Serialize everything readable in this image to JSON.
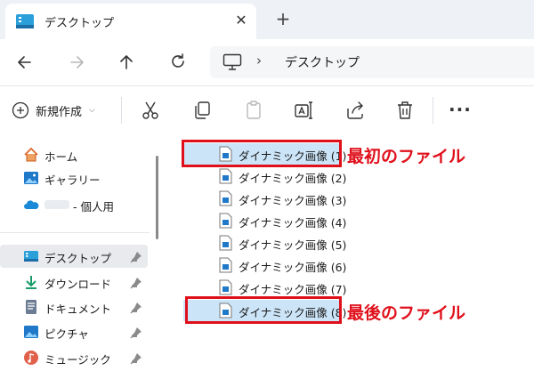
{
  "window": {
    "tab_title": "デスクトップ",
    "tab_close": "✕",
    "new_tab": "+"
  },
  "address": {
    "separator": "›",
    "location": "デスクトップ"
  },
  "toolbar": {
    "new_label": "新規作成",
    "new_caret": "⌵",
    "more": "···"
  },
  "sidebar": {
    "items": [
      {
        "label": "ホーム",
        "icon": "home-icon"
      },
      {
        "label": "ギャラリー",
        "icon": "gallery-icon"
      },
      {
        "label": "- 個人用",
        "icon": "onedrive-cloud-icon"
      },
      {
        "label": "デスクトップ",
        "icon": "desktop-icon",
        "selected": true,
        "pinned": true
      },
      {
        "label": "ダウンロード",
        "icon": "download-icon",
        "pinned": true
      },
      {
        "label": "ドキュメント",
        "icon": "documents-icon",
        "pinned": true
      },
      {
        "label": "ピクチャ",
        "icon": "pictures-icon",
        "pinned": true
      },
      {
        "label": "ミュージック",
        "icon": "music-icon",
        "pinned": true
      }
    ]
  },
  "files": [
    {
      "name": "ダイナミック画像 (1)"
    },
    {
      "name": "ダイナミック画像 (2)"
    },
    {
      "name": "ダイナミック画像 (3)"
    },
    {
      "name": "ダイナミック画像 (4)"
    },
    {
      "name": "ダイナミック画像 (5)"
    },
    {
      "name": "ダイナミック画像 (6)"
    },
    {
      "name": "ダイナミック画像 (7)"
    },
    {
      "name": "ダイナミック画像 (8)"
    }
  ],
  "annotations": {
    "first_label": "最初のファイル",
    "last_label": "最後のファイル"
  },
  "colors": {
    "highlight": "#e0101b",
    "selection": "#cce4f7",
    "accent": "#0067c0"
  }
}
